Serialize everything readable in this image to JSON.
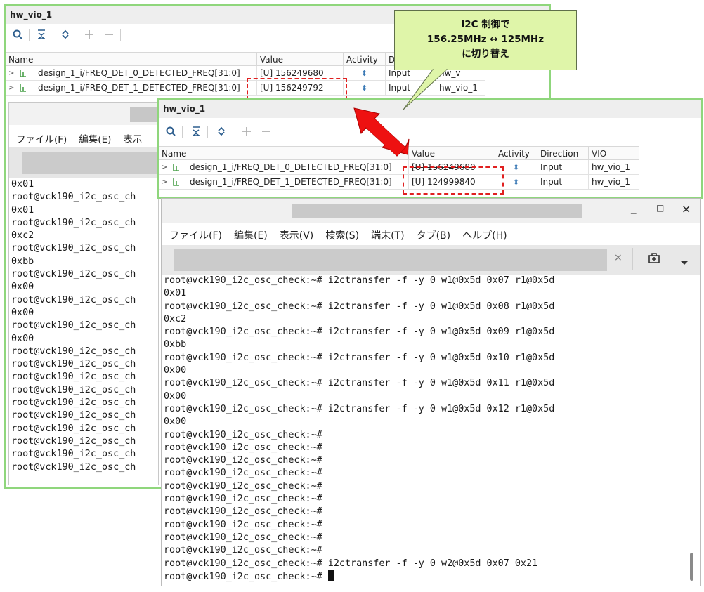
{
  "back_vio": {
    "title": "hw_vio_1",
    "headers": {
      "name": "Name",
      "value": "Value",
      "activity": "Activity",
      "direction": "D"
    },
    "rows": [
      {
        "name": "design_1_i/FREQ_DET_0_DETECTED_FREQ[31:0]",
        "value": "[U] 156249680",
        "direction": "Input",
        "vio": "hw_v"
      },
      {
        "name": "design_1_i/FREQ_DET_1_DETECTED_FREQ[31:0]",
        "value": "[U] 156249792",
        "direction": "Input",
        "vio": "hw_vio_1"
      }
    ]
  },
  "front_vio": {
    "title": "hw_vio_1",
    "headers": {
      "name": "Name",
      "value": "Value",
      "activity": "Activity",
      "direction": "Direction",
      "vio": "VIO"
    },
    "rows": [
      {
        "name": "design_1_i/FREQ_DET_0_DETECTED_FREQ[31:0]",
        "value": "[U] 156249680",
        "direction": "Input",
        "vio": "hw_vio_1"
      },
      {
        "name": "design_1_i/FREQ_DET_1_DETECTED_FREQ[31:0]",
        "value": "[U] 124999840",
        "direction": "Input",
        "vio": "hw_vio_1"
      }
    ]
  },
  "callout": {
    "line1": "I2C 制御で",
    "line2": "156.25MHz ↔ 125MHz",
    "line3": "に切り替え"
  },
  "back_terminal": {
    "menu": [
      "ファイル(F)",
      "編集(E)",
      "表示"
    ],
    "lines": [
      "0x01",
      "root@vck190_i2c_osc_ch",
      "0x01",
      "root@vck190_i2c_osc_ch",
      "0xc2",
      "root@vck190_i2c_osc_ch",
      "0xbb",
      "root@vck190_i2c_osc_ch",
      "0x00",
      "root@vck190_i2c_osc_ch",
      "0x00",
      "root@vck190_i2c_osc_ch",
      "0x00",
      "root@vck190_i2c_osc_ch",
      "root@vck190_i2c_osc_ch",
      "root@vck190_i2c_osc_ch",
      "root@vck190_i2c_osc_ch",
      "root@vck190_i2c_osc_ch",
      "root@vck190_i2c_osc_ch",
      "root@vck190_i2c_osc_ch",
      "root@vck190_i2c_osc_ch",
      "root@vck190_i2c_osc_ch",
      "root@vck190_i2c_osc_ch"
    ]
  },
  "front_terminal": {
    "window_controls": {
      "minimize": "_",
      "maximize": "□",
      "close": "×"
    },
    "menu": [
      "ファイル(F)",
      "編集(E)",
      "表示(V)",
      "検索(S)",
      "端末(T)",
      "タブ(B)",
      "ヘルプ(H)"
    ],
    "tab_close": "×",
    "lines": [
      "root@vck190_i2c_osc_check:~# i2ctransfer -f -y 0 w1@0x5d 0x07 r1@0x5d",
      "0x01",
      "root@vck190_i2c_osc_check:~# i2ctransfer -f -y 0 w1@0x5d 0x08 r1@0x5d",
      "0xc2",
      "root@vck190_i2c_osc_check:~# i2ctransfer -f -y 0 w1@0x5d 0x09 r1@0x5d",
      "0xbb",
      "root@vck190_i2c_osc_check:~# i2ctransfer -f -y 0 w1@0x5d 0x10 r1@0x5d",
      "0x00",
      "root@vck190_i2c_osc_check:~# i2ctransfer -f -y 0 w1@0x5d 0x11 r1@0x5d",
      "0x00",
      "root@vck190_i2c_osc_check:~# i2ctransfer -f -y 0 w1@0x5d 0x12 r1@0x5d",
      "0x00",
      "root@vck190_i2c_osc_check:~#",
      "root@vck190_i2c_osc_check:~#",
      "root@vck190_i2c_osc_check:~#",
      "root@vck190_i2c_osc_check:~#",
      "root@vck190_i2c_osc_check:~#",
      "root@vck190_i2c_osc_check:~#",
      "root@vck190_i2c_osc_check:~#",
      "root@vck190_i2c_osc_check:~#",
      "root@vck190_i2c_osc_check:~#",
      "root@vck190_i2c_osc_check:~#",
      "root@vck190_i2c_osc_check:~# i2ctransfer -f -y 0 w2@0x5d 0x07 0x21",
      "root@vck190_i2c_osc_check:~# "
    ]
  },
  "colors": {
    "vio_border": "#8fd67c",
    "highlight_dash": "#e02020",
    "arrow": "#ee1111",
    "callout_bg": "#dff5a9"
  }
}
